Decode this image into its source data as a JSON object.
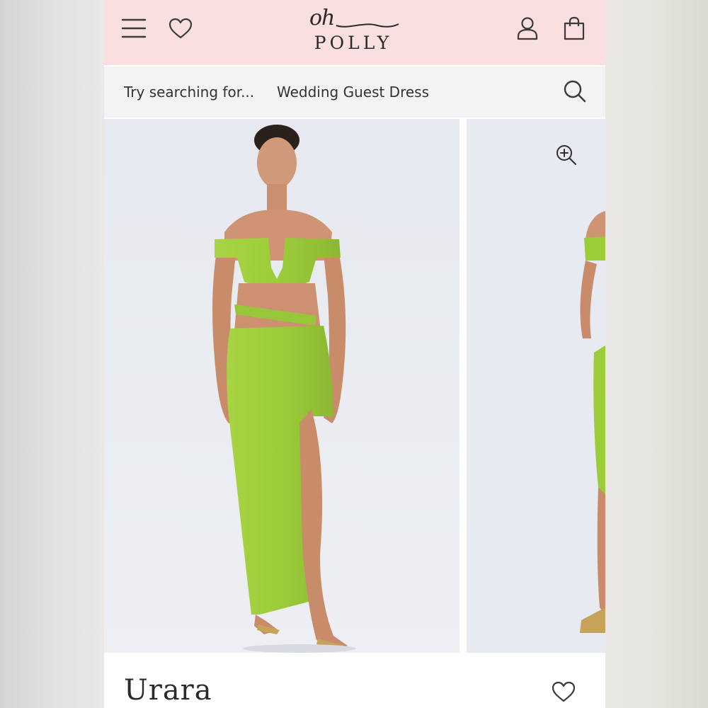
{
  "header": {
    "logo": {
      "script": "oh",
      "wordmark": "POLLY"
    },
    "icons": [
      "menu-icon",
      "heart-icon",
      "account-icon",
      "shopping-bag-icon"
    ]
  },
  "search": {
    "prefix": "Try searching for...",
    "suggestion": "Wedding Guest Dress"
  },
  "gallery": {
    "image_count_visible": 2,
    "dress_color": "#9ccc3a"
  },
  "product": {
    "title": "Urara"
  },
  "colors": {
    "header_bg": "#f9dfe0",
    "search_bg": "#f3f3f3",
    "image_bg": "#e8ebf1",
    "ink": "#2b2b2b"
  }
}
